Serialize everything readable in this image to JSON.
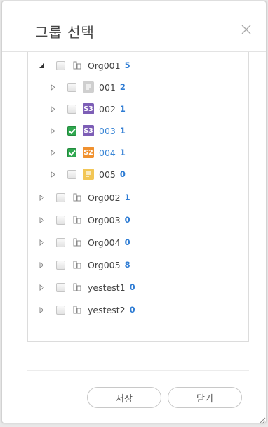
{
  "dialog": {
    "title": "그룹 선택",
    "save_label": "저장",
    "close_label": "닫기"
  },
  "tree": {
    "root": {
      "name": "Org001",
      "count": "5"
    },
    "children": [
      {
        "name": "001",
        "count": "2",
        "icon": "doc-icon",
        "checked": false
      },
      {
        "name": "002",
        "count": "1",
        "icon": "S3",
        "checked": false
      },
      {
        "name": "003",
        "count": "1",
        "icon": "S3",
        "checked": true
      },
      {
        "name": "004",
        "count": "1",
        "icon": "S2",
        "checked": true
      },
      {
        "name": "005",
        "count": "0",
        "icon": "doc-icon",
        "checked": false
      }
    ],
    "orgs": [
      {
        "name": "Org002",
        "count": "1"
      },
      {
        "name": "Org003",
        "count": "0"
      },
      {
        "name": "Org004",
        "count": "0"
      },
      {
        "name": "Org005",
        "count": "8"
      },
      {
        "name": "yestest1",
        "count": "0"
      },
      {
        "name": "yestest2",
        "count": "0"
      }
    ]
  },
  "colors": {
    "accent": "#2e7cd4",
    "check": "#2fa84f",
    "badge_s3": "#7d5eb6",
    "badge_s2": "#f0912f"
  }
}
